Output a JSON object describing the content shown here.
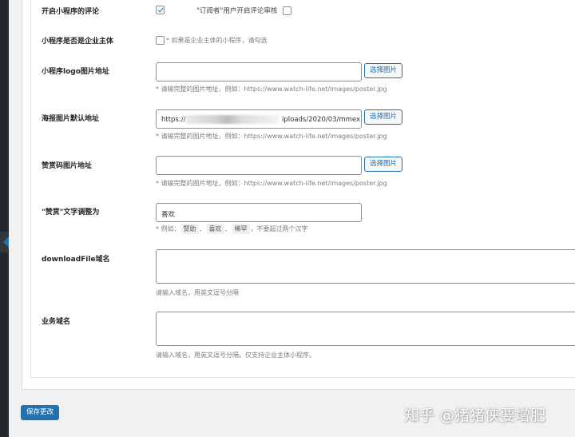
{
  "rows": {
    "comment": {
      "label": "开启小程序的评论",
      "checked": true,
      "subscriber_label": "\"订阅者\"用户开启评论审核",
      "subscriber_checked": false
    },
    "enterprise": {
      "label": "小程序是否是企业主体",
      "checked": false,
      "hint": "* 如果是企业主体的小程序，请勾选"
    },
    "logo": {
      "label": "小程序logo图片地址",
      "value": "",
      "button": "选择图片",
      "hint": "* 请输完整的图片地址，例如：https://www.watch-life.net/images/poster.jpg"
    },
    "poster": {
      "label": "海报图片默认地址",
      "value_start": "https://",
      "value_end": "iploads/2020/03/mmex",
      "button": "选择图片",
      "hint": "* 请输完整的图片地址，例如：https://www.watch-life.net/images/poster.jpg"
    },
    "reward_code": {
      "label": "赞赏码图片地址",
      "value": "",
      "button": "选择图片",
      "hint": "* 请输完整的图片地址，例如：https://www.watch-life.net/images/poster.jpg"
    },
    "reward_text": {
      "label": "\"赞赏\"文字调整为",
      "value": "喜欢",
      "hint_prefix": "* 例如：",
      "examples": [
        "赞助",
        "喜欢",
        "稀罕"
      ],
      "hint_suffix": "，不要超过两个汉字"
    },
    "download_domain": {
      "label": "downloadFile域名",
      "value": "",
      "hint": "请输入域名，用英文逗号分隔"
    },
    "business_domain": {
      "label": "业务域名",
      "value": "",
      "hint": "请输入域名，用英文逗号分隔。仅支持企业主体小程序。"
    }
  },
  "save_button": "保存更改",
  "watermark": "知乎 @猪猪侠要增肥",
  "colors": {
    "accent": "#2271b1",
    "admin_sidebar": "#23282d",
    "page_bg": "#f1f1f1"
  }
}
